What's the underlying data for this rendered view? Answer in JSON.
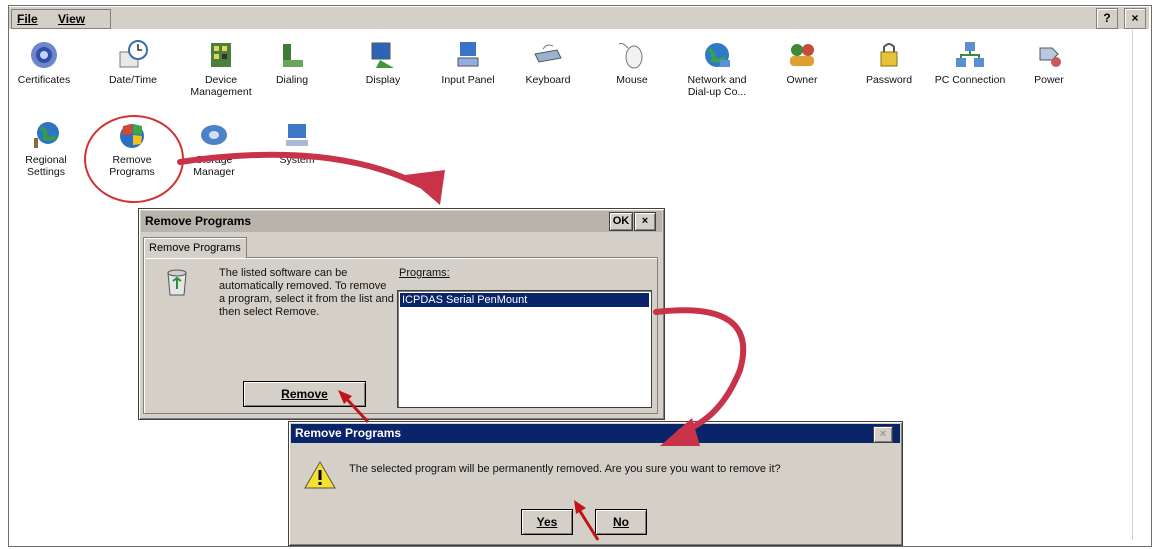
{
  "menubar": {
    "items": [
      {
        "label": "File",
        "name": "file-menu"
      },
      {
        "label": "View",
        "name": "view-menu"
      }
    ],
    "help_label": "?",
    "close_label": "×"
  },
  "control_panel": {
    "icons": [
      {
        "label": "Certificates",
        "icon": "certificates-icon"
      },
      {
        "label": "Date/Time",
        "icon": "date-time-icon"
      },
      {
        "label": "Device Management",
        "icon": "device-management-icon"
      },
      {
        "label": "Dialing",
        "icon": "dialing-icon"
      },
      {
        "label": "Display",
        "icon": "display-icon"
      },
      {
        "label": "Input Panel",
        "icon": "input-panel-icon"
      },
      {
        "label": "Keyboard",
        "icon": "keyboard-icon"
      },
      {
        "label": "Mouse",
        "icon": "mouse-icon"
      },
      {
        "label": "Network and Dial-up Co...",
        "icon": "network-icon"
      },
      {
        "label": "Owner",
        "icon": "owner-icon"
      },
      {
        "label": "Password",
        "icon": "password-icon"
      },
      {
        "label": "PC Connection",
        "icon": "pc-connection-icon"
      },
      {
        "label": "Power",
        "icon": "power-icon"
      },
      {
        "label": "Regional Settings",
        "icon": "regional-settings-icon"
      },
      {
        "label": "Remove Programs",
        "icon": "remove-programs-icon"
      },
      {
        "label": "Storage Manager",
        "icon": "storage-manager-icon"
      },
      {
        "label": "System",
        "icon": "system-icon"
      }
    ]
  },
  "remove_dialog": {
    "title": "Remove Programs",
    "ok_label": "OK",
    "close_label": "×",
    "tab_label": "Remove Programs",
    "description": "The listed software can be automatically removed. To remove a program, select it from the list and then select Remove.",
    "programs_label": "Programs:",
    "programs": [
      "ICPDAS Serial PenMount"
    ],
    "remove_button": "Remove"
  },
  "confirm_dialog": {
    "title": "Remove Programs",
    "close_label": "×",
    "message": "The selected program will be permanently removed. Are you sure you want to remove it?",
    "yes_button": "Yes",
    "no_button": "No"
  },
  "colors": {
    "annotation_arrow": "#c8334a",
    "annotation_pointer": "#c0141a",
    "title_active": "#0a246a",
    "dialog_face": "#d4d0c8"
  }
}
